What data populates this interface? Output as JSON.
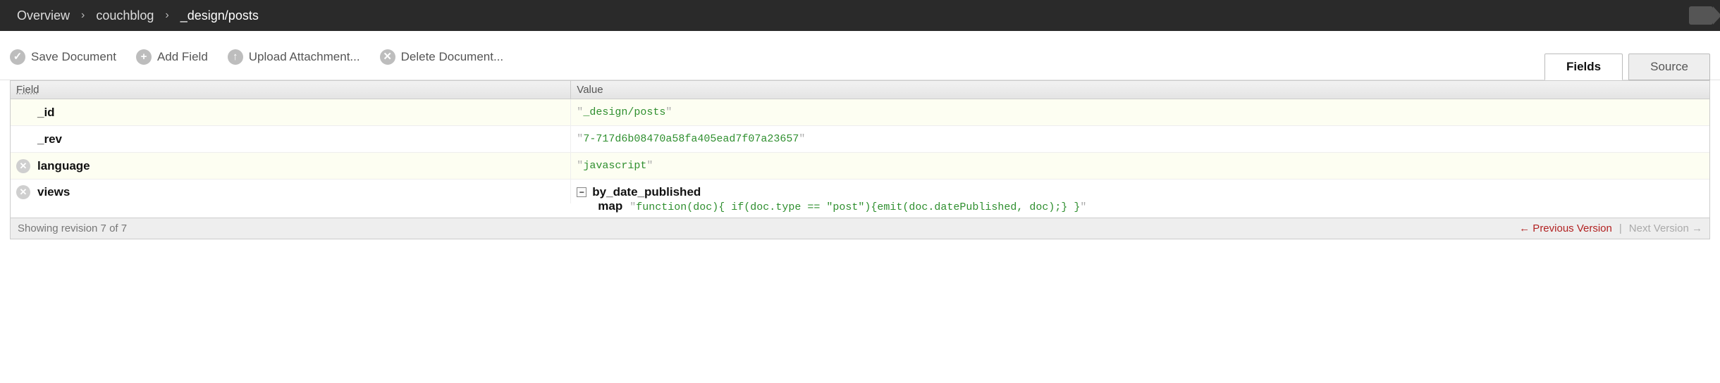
{
  "breadcrumb": {
    "items": [
      {
        "label": "Overview"
      },
      {
        "label": "couchblog"
      },
      {
        "label": "_design/posts"
      }
    ]
  },
  "toolbar": {
    "save_label": "Save Document",
    "add_field_label": "Add Field",
    "upload_label": "Upload Attachment...",
    "delete_label": "Delete Document..."
  },
  "tabs": {
    "fields_label": "Fields",
    "source_label": "Source"
  },
  "table": {
    "head_field": "Field",
    "head_value": "Value"
  },
  "rows": {
    "id": {
      "name": "_id",
      "value": "_design/posts"
    },
    "rev": {
      "name": "_rev",
      "value": "7-717d6b08470a58fa405ead7f07a23657"
    },
    "language": {
      "name": "language",
      "value": "javascript"
    },
    "views": {
      "name": "views",
      "view_name": "by_date_published",
      "map_label": "map",
      "map_code": "function(doc){ if(doc.type == \"post\"){emit(doc.datePublished, doc);} }"
    }
  },
  "footer": {
    "revision_text": "Showing revision 7 of 7",
    "prev_label": "← Previous Version",
    "next_label": "Next Version →"
  }
}
